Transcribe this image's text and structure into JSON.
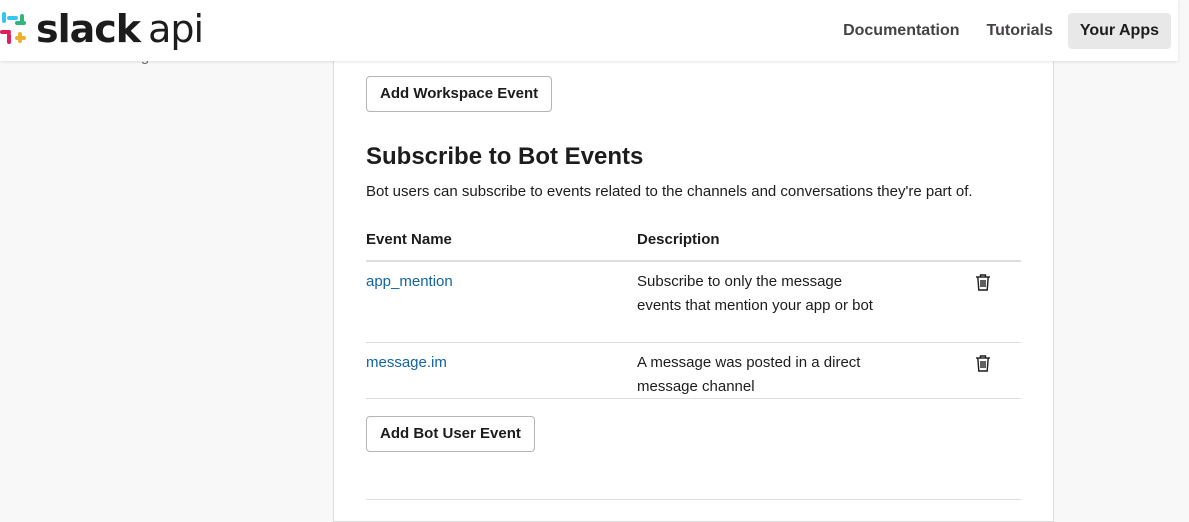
{
  "header": {
    "brand": {
      "word": "slack",
      "suffix": "api"
    },
    "nav": [
      {
        "label": "Documentation"
      },
      {
        "label": "Tutorials"
      },
      {
        "label": "Your Apps",
        "active": true
      }
    ]
  },
  "sidebar": {
    "partial_link": "Our Blog"
  },
  "workspace_events": {
    "add_button_label": "Add Workspace Event"
  },
  "bot_events": {
    "title": "Subscribe to Bot Events",
    "description": "Bot users can subscribe to events related to the channels and conversations they're part of.",
    "columns": {
      "name": "Event Name",
      "description": "Description"
    },
    "rows": [
      {
        "name": "app_mention",
        "description": "Subscribe to only the message events that mention your app or bot",
        "action_icon": "trash-icon"
      },
      {
        "name": "message.im",
        "description": "A message was posted in a direct message channel",
        "action_icon": "trash-icon"
      }
    ],
    "add_button_label": "Add Bot User Event"
  },
  "colors": {
    "link": "#1264a3",
    "text": "#1d1c1d",
    "nav_active_bg": "#e8e8e8"
  }
}
